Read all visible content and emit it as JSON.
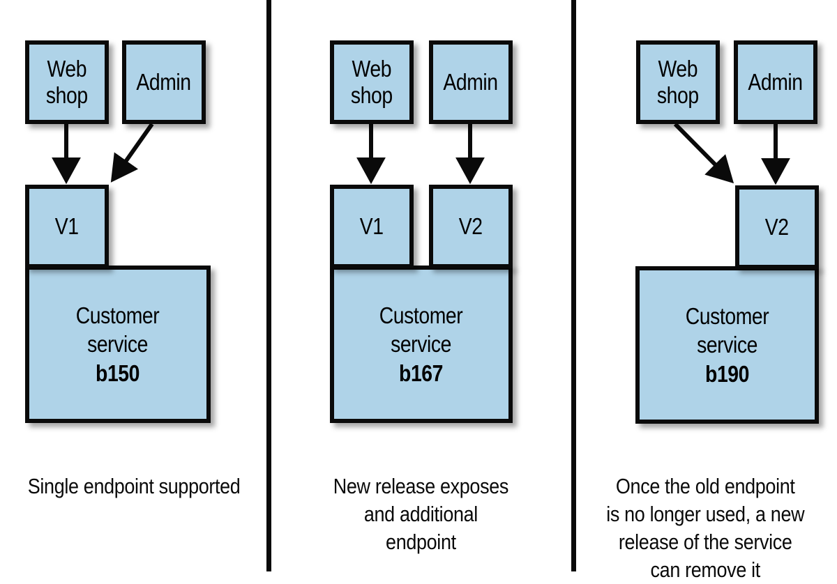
{
  "figure": {
    "type": "diagram",
    "subject": "API versioning / endpoint lifecycle across three service releases",
    "box_fill_color": "#afd3e8",
    "box_border_color": "#0a0a0a",
    "background_color": "#ffffff"
  },
  "panels": [
    {
      "id": "panel-1",
      "clients": [
        {
          "name": "web-shop",
          "label": "Web\nshop"
        },
        {
          "name": "admin",
          "label": "Admin"
        }
      ],
      "endpoints": [
        {
          "name": "v1",
          "label": "V1"
        }
      ],
      "service": {
        "title": "Customer\nservice",
        "build": "b150"
      },
      "connections": [
        {
          "from": "Web shop",
          "to": "V1",
          "style": "straight"
        },
        {
          "from": "Admin",
          "to": "V1",
          "style": "diagonal"
        }
      ],
      "caption": "Single endpoint supported"
    },
    {
      "id": "panel-2",
      "clients": [
        {
          "name": "web-shop",
          "label": "Web\nshop"
        },
        {
          "name": "admin",
          "label": "Admin"
        }
      ],
      "endpoints": [
        {
          "name": "v1",
          "label": "V1"
        },
        {
          "name": "v2",
          "label": "V2"
        }
      ],
      "service": {
        "title": "Customer\nservice",
        "build": "b167"
      },
      "connections": [
        {
          "from": "Web shop",
          "to": "V1",
          "style": "straight"
        },
        {
          "from": "Admin",
          "to": "V2",
          "style": "straight"
        }
      ],
      "caption": "New release exposes\nand additional\nendpoint"
    },
    {
      "id": "panel-3",
      "clients": [
        {
          "name": "web-shop",
          "label": "Web\nshop"
        },
        {
          "name": "admin",
          "label": "Admin"
        }
      ],
      "endpoints": [
        {
          "name": "v2",
          "label": "V2"
        }
      ],
      "service": {
        "title": "Customer\nservice",
        "build": "b190"
      },
      "connections": [
        {
          "from": "Web shop",
          "to": "V2",
          "style": "diagonal"
        },
        {
          "from": "Admin",
          "to": "V2",
          "style": "straight"
        }
      ],
      "caption": "Once the old endpoint\nis no longer used, a new\nrelease of the service\ncan remove it"
    }
  ]
}
